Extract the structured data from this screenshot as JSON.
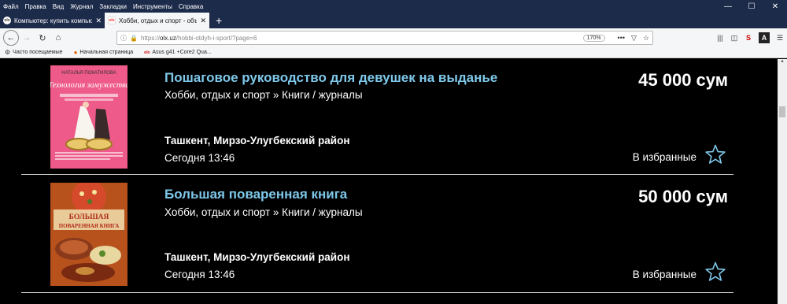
{
  "menu": [
    "Файл",
    "Правка",
    "Вид",
    "Журнал",
    "Закладки",
    "Инструменты",
    "Справка"
  ],
  "tabs": [
    {
      "title": "Компьютер: купить компьюте",
      "favicon": "olx",
      "active": false
    },
    {
      "title": "Хобби, отдых и спорт - объяв",
      "favicon": "olx",
      "active": true
    }
  ],
  "url": {
    "prefix": "https://",
    "host": "olx.uz",
    "path": "/hobbi-otdyh-i-sport/?page=6"
  },
  "zoom": "170%",
  "bookmarks": [
    {
      "label": "Часто посещаемые",
      "icon": "gear-icon"
    },
    {
      "label": "Начальная страница",
      "icon": "firefox-icon"
    },
    {
      "label": "Asus g41 +Core2 Qua...",
      "icon": "olx-icon"
    }
  ],
  "listings": [
    {
      "title": "Пошаговое руководство для девушек на выданье",
      "category": "Хобби, отдых и спорт » Книги / журналы",
      "price": "45 000 сум",
      "location": "Ташкент, Мирзо-Улугбекский район",
      "date": "Сегодня 13:46",
      "fav_label": "В избранные",
      "cover": {
        "author": "НАТАЛЬЯ ПОКАТИЛОВА",
        "name": "Технология замужества"
      }
    },
    {
      "title": "Большая поваренная книга",
      "category": "Хобби, отдых и спорт » Книги / журналы",
      "price": "50 000 сум",
      "location": "Ташкент, Мирзо-Улугбекский район",
      "date": "Сегодня 13:46",
      "fav_label": "В избранные",
      "cover": {
        "name_line1": "БОЛЬШАЯ",
        "name_line2": "ПОВАРЕННАЯ КНИГА"
      }
    }
  ],
  "colors": {
    "title": "#7ec8ea",
    "star": "#7ec8ea",
    "chrome": "#1c2b4a"
  }
}
